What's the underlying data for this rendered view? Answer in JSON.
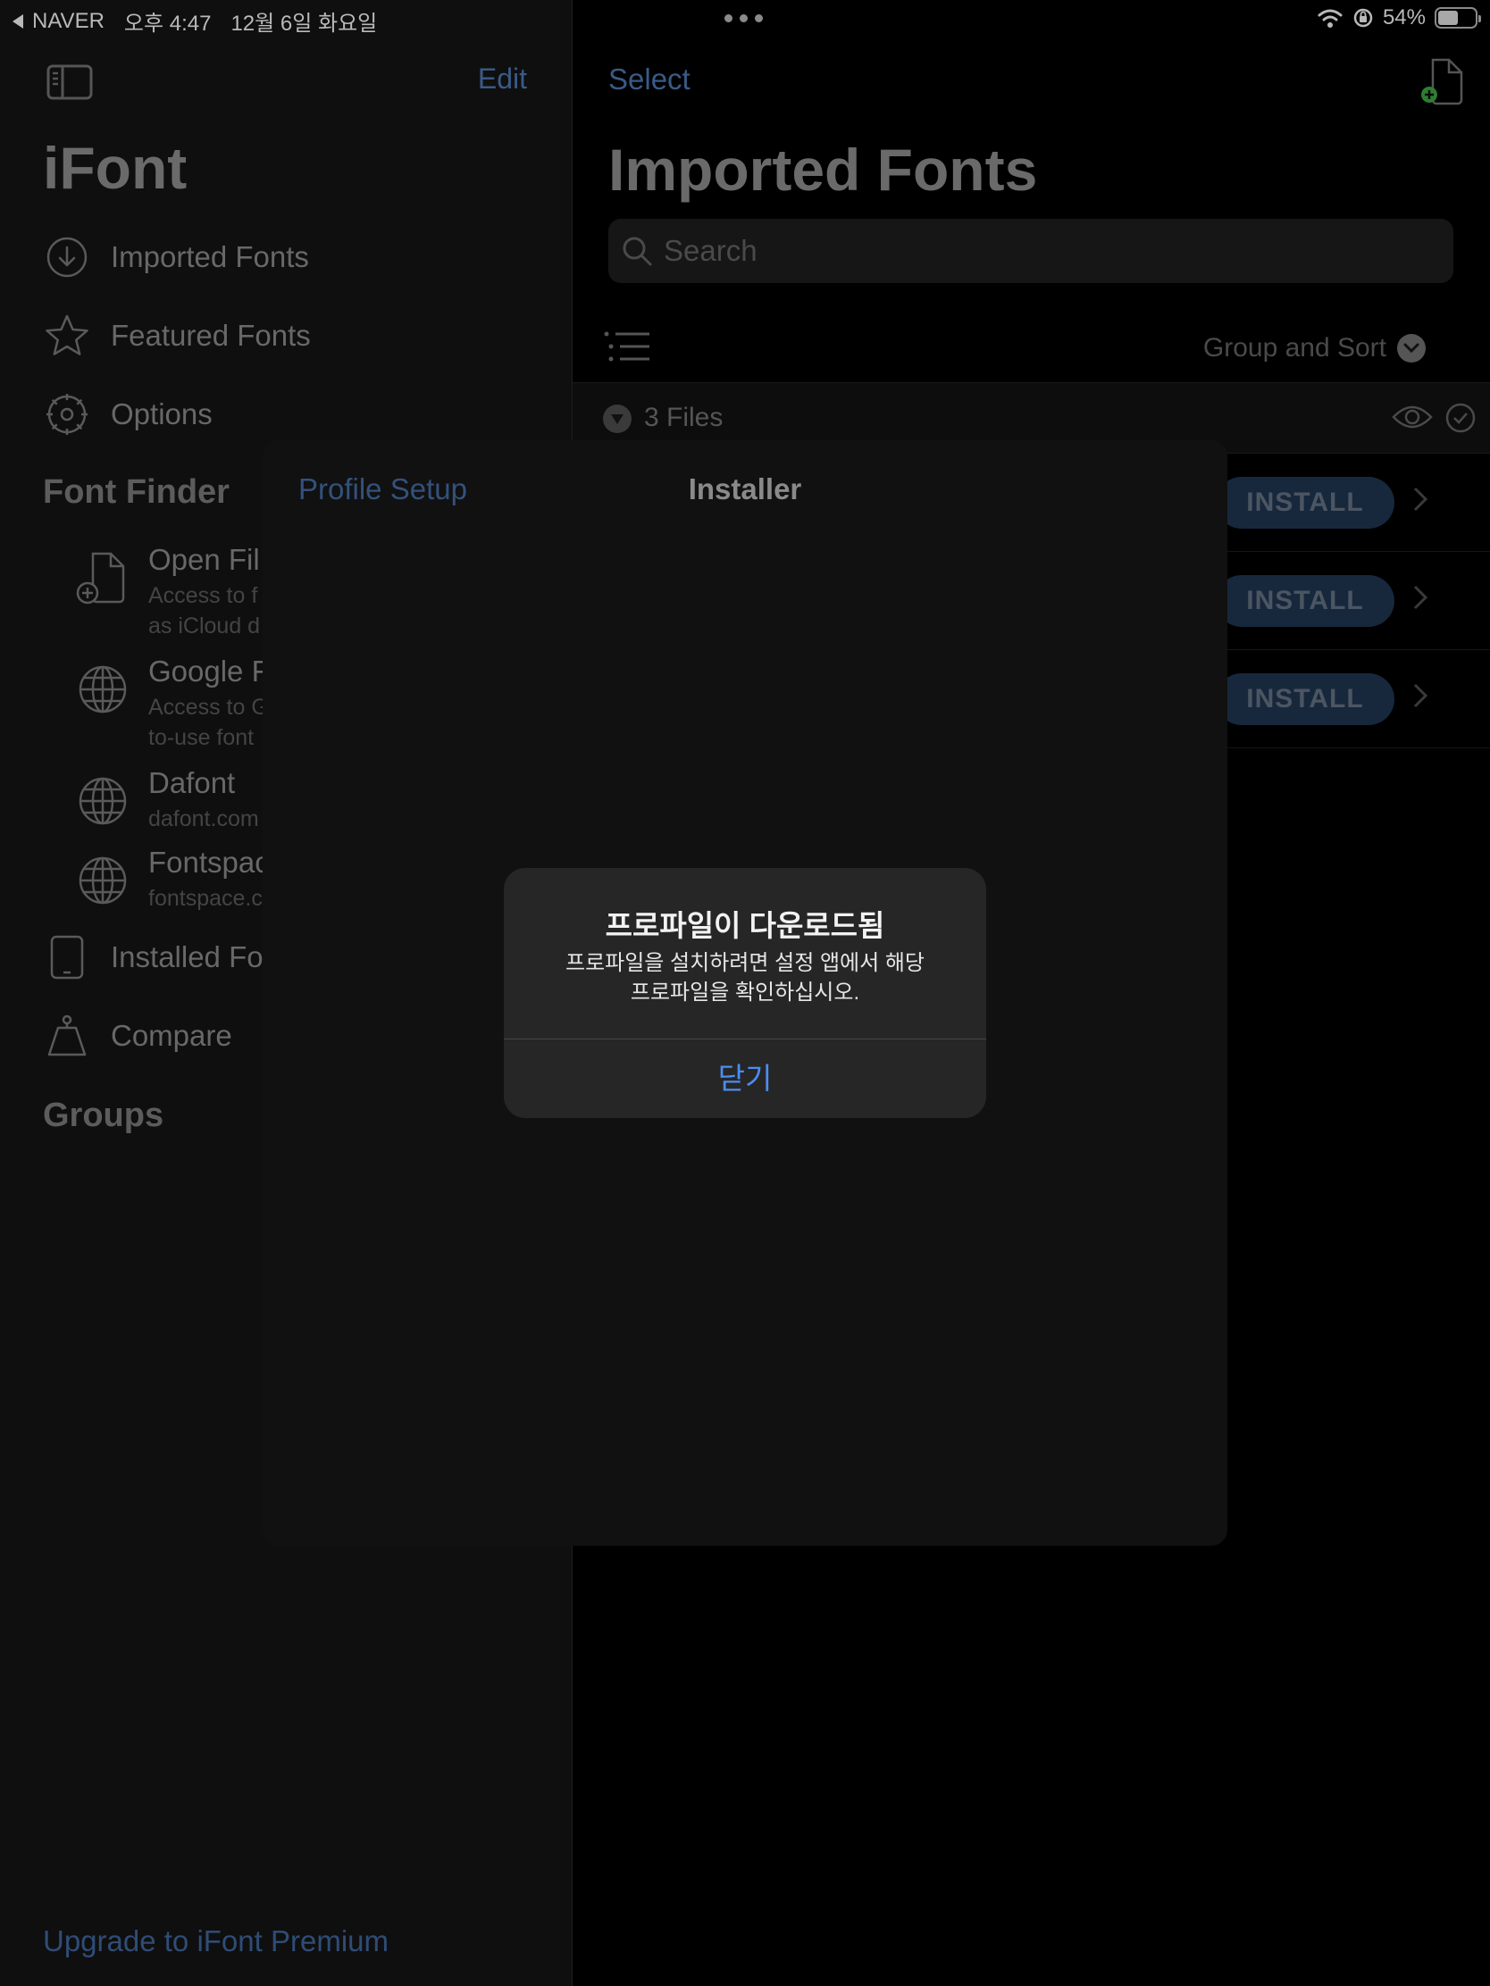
{
  "status_bar": {
    "back_app": "NAVER",
    "time": "오후 4:47",
    "date": "12월 6일 화요일",
    "battery": "54%",
    "battery_level": 0.54
  },
  "sidebar": {
    "edit_label": "Edit",
    "app_title": "iFont",
    "nav": [
      {
        "label": "Imported Fonts",
        "icon": "download-circle-icon"
      },
      {
        "label": "Featured Fonts",
        "icon": "star-icon"
      },
      {
        "label": "Options",
        "icon": "gear-icon"
      }
    ],
    "font_finder_title": "Font Finder",
    "finder": [
      {
        "title": "Open Fil",
        "sub1": "Access to f",
        "sub2": "as iCloud d",
        "icon": "add-file-icon"
      },
      {
        "title": "Google F",
        "sub1": "Access to G",
        "sub2": "to-use font",
        "icon": "globe-icon"
      },
      {
        "title": "Dafont",
        "sub1": "dafont.com",
        "icon": "globe-icon"
      },
      {
        "title": "Fontspac",
        "sub1": "fontspace.c",
        "icon": "globe-icon"
      }
    ],
    "nav2": [
      {
        "label": "Installed Fo",
        "icon": "tablet-icon"
      },
      {
        "label": "Compare",
        "icon": "scale-icon"
      }
    ],
    "groups_title": "Groups",
    "upgrade_label": "Upgrade to iFont Premium"
  },
  "main": {
    "select_label": "Select",
    "title": "Imported Fonts",
    "search_placeholder": "Search",
    "group_sort_label": "Group and Sort",
    "files_count": "3 Files",
    "rows": [
      {
        "install_label": "INSTALL"
      },
      {
        "install_label": "INSTALL"
      },
      {
        "install_label": "INSTALL"
      }
    ]
  },
  "sheet": {
    "left_label": "Profile Setup",
    "title": "Installer"
  },
  "alert": {
    "title": "프로파일이 다운로드됨",
    "message_line1": "프로파일을 설치하려면 설정 앱에서 해당",
    "message_line2": "프로파일을 확인하십시오.",
    "button": "닫기"
  },
  "colors": {
    "accent": "#4c8df0",
    "dim_accent": "#3a5a86",
    "add_badge": "#2e7d32"
  }
}
